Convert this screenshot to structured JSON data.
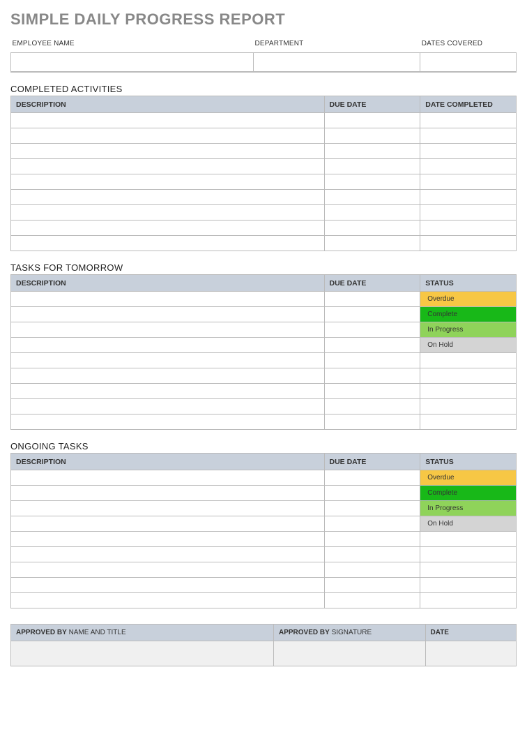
{
  "title": "SIMPLE DAILY PROGRESS REPORT",
  "info": {
    "employee_label": "EMPLOYEE NAME",
    "department_label": "DEPARTMENT",
    "dates_label": "DATES COVERED",
    "employee_value": "",
    "department_value": "",
    "dates_value": ""
  },
  "completed": {
    "heading": "COMPLETED ACTIVITIES",
    "cols": {
      "desc": "DESCRIPTION",
      "due": "DUE DATE",
      "done": "DATE COMPLETED"
    },
    "rows": [
      {
        "desc": "",
        "due": "",
        "done": ""
      },
      {
        "desc": "",
        "due": "",
        "done": ""
      },
      {
        "desc": "",
        "due": "",
        "done": ""
      },
      {
        "desc": "",
        "due": "",
        "done": ""
      },
      {
        "desc": "",
        "due": "",
        "done": ""
      },
      {
        "desc": "",
        "due": "",
        "done": ""
      },
      {
        "desc": "",
        "due": "",
        "done": ""
      },
      {
        "desc": "",
        "due": "",
        "done": ""
      },
      {
        "desc": "",
        "due": "",
        "done": ""
      }
    ]
  },
  "tomorrow": {
    "heading": "TASKS FOR TOMORROW",
    "cols": {
      "desc": "DESCRIPTION",
      "due": "DUE DATE",
      "status": "STATUS"
    },
    "rows": [
      {
        "desc": "",
        "due": "",
        "status": "Overdue",
        "status_class": "status-overdue"
      },
      {
        "desc": "",
        "due": "",
        "status": "Complete",
        "status_class": "status-complete"
      },
      {
        "desc": "",
        "due": "",
        "status": "In Progress",
        "status_class": "status-inprogress"
      },
      {
        "desc": "",
        "due": "",
        "status": "On Hold",
        "status_class": "status-onhold"
      },
      {
        "desc": "",
        "due": "",
        "status": "",
        "status_class": ""
      },
      {
        "desc": "",
        "due": "",
        "status": "",
        "status_class": ""
      },
      {
        "desc": "",
        "due": "",
        "status": "",
        "status_class": ""
      },
      {
        "desc": "",
        "due": "",
        "status": "",
        "status_class": ""
      },
      {
        "desc": "",
        "due": "",
        "status": "",
        "status_class": ""
      }
    ]
  },
  "ongoing": {
    "heading": "ONGOING TASKS",
    "cols": {
      "desc": "DESCRIPTION",
      "due": "DUE DATE",
      "status": "STATUS"
    },
    "rows": [
      {
        "desc": "",
        "due": "",
        "status": "Overdue",
        "status_class": "status-overdue"
      },
      {
        "desc": "",
        "due": "",
        "status": "Complete",
        "status_class": "status-complete"
      },
      {
        "desc": "",
        "due": "",
        "status": "In Progress",
        "status_class": "status-inprogress"
      },
      {
        "desc": "",
        "due": "",
        "status": "On Hold",
        "status_class": "status-onhold"
      },
      {
        "desc": "",
        "due": "",
        "status": "",
        "status_class": ""
      },
      {
        "desc": "",
        "due": "",
        "status": "",
        "status_class": ""
      },
      {
        "desc": "",
        "due": "",
        "status": "",
        "status_class": ""
      },
      {
        "desc": "",
        "due": "",
        "status": "",
        "status_class": ""
      },
      {
        "desc": "",
        "due": "",
        "status": "",
        "status_class": ""
      }
    ]
  },
  "approval": {
    "by_bold": "APPROVED BY",
    "by_rest": " NAME AND TITLE",
    "sig_bold": "APPROVED BY",
    "sig_rest": " SIGNATURE",
    "date_bold": "DATE",
    "by_value": "",
    "sig_value": "",
    "date_value": ""
  }
}
